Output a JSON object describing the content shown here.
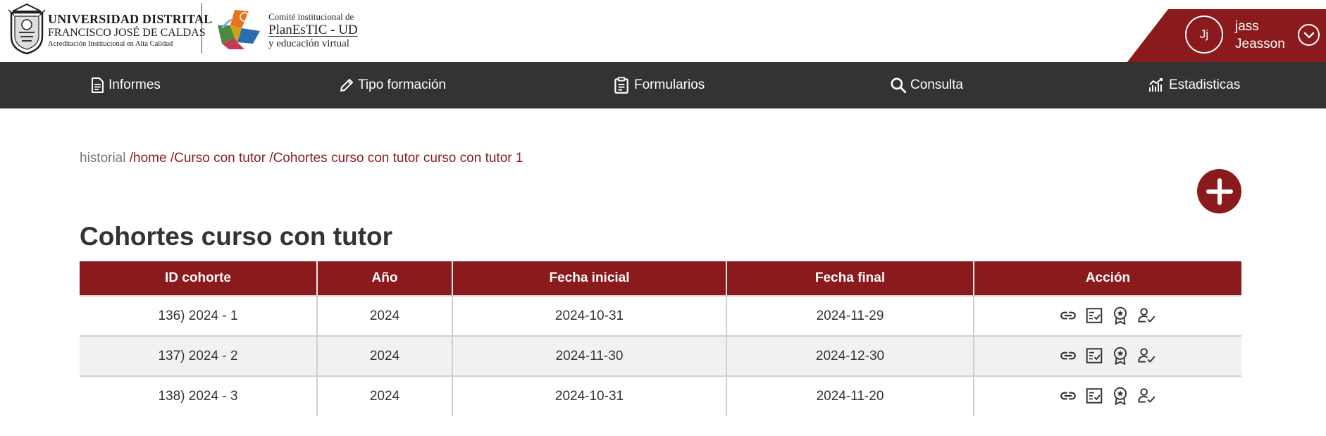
{
  "header": {
    "university": {
      "line1": "UNIVERSIDAD DISTRITAL",
      "line2": "FRANCISCO JOSÉ DE CALDAS",
      "line3": "Acreditación Institucional en Alta Calidad"
    },
    "committee": {
      "line1": "Comité institucional de",
      "line2": "PlanEsTIC - UD",
      "line3": "y educación virtual"
    },
    "user": {
      "initials": "Jj",
      "first_name": "jass",
      "last_name": "Jeasson"
    }
  },
  "nav": {
    "items": [
      {
        "label": "Informes",
        "icon": "document-icon"
      },
      {
        "label": "Tipo formación",
        "icon": "pencil-icon"
      },
      {
        "label": "Formularios",
        "icon": "clipboard-icon"
      },
      {
        "label": "Consulta",
        "icon": "search-icon"
      },
      {
        "label": "Estadisticas",
        "icon": "stats-icon"
      }
    ]
  },
  "breadcrumb": {
    "history_label": "historial",
    "items": [
      " /home",
      " /Curso con tutor",
      " /Cohortes curso con tutor curso con tutor 1"
    ]
  },
  "page": {
    "title": "Cohortes curso con tutor"
  },
  "table": {
    "columns": [
      "ID cohorte",
      "Año",
      "Fecha inicial",
      "Fecha final",
      "Acción"
    ],
    "rows": [
      {
        "id": "136) 2024 - 1",
        "year": "2024",
        "start": "2024-10-31",
        "end": "2024-11-29"
      },
      {
        "id": "137) 2024 - 2",
        "year": "2024",
        "start": "2024-11-30",
        "end": "2024-12-30"
      },
      {
        "id": "138) 2024 - 3",
        "year": "2024",
        "start": "2024-10-31",
        "end": "2024-11-20"
      }
    ],
    "action_icons": [
      "link-icon",
      "checklist-icon",
      "award-icon",
      "user-check-icon"
    ]
  },
  "colors": {
    "brand_red": "#8b1a1c",
    "nav_bg": "#333333",
    "link_red": "#8a1a1e"
  }
}
